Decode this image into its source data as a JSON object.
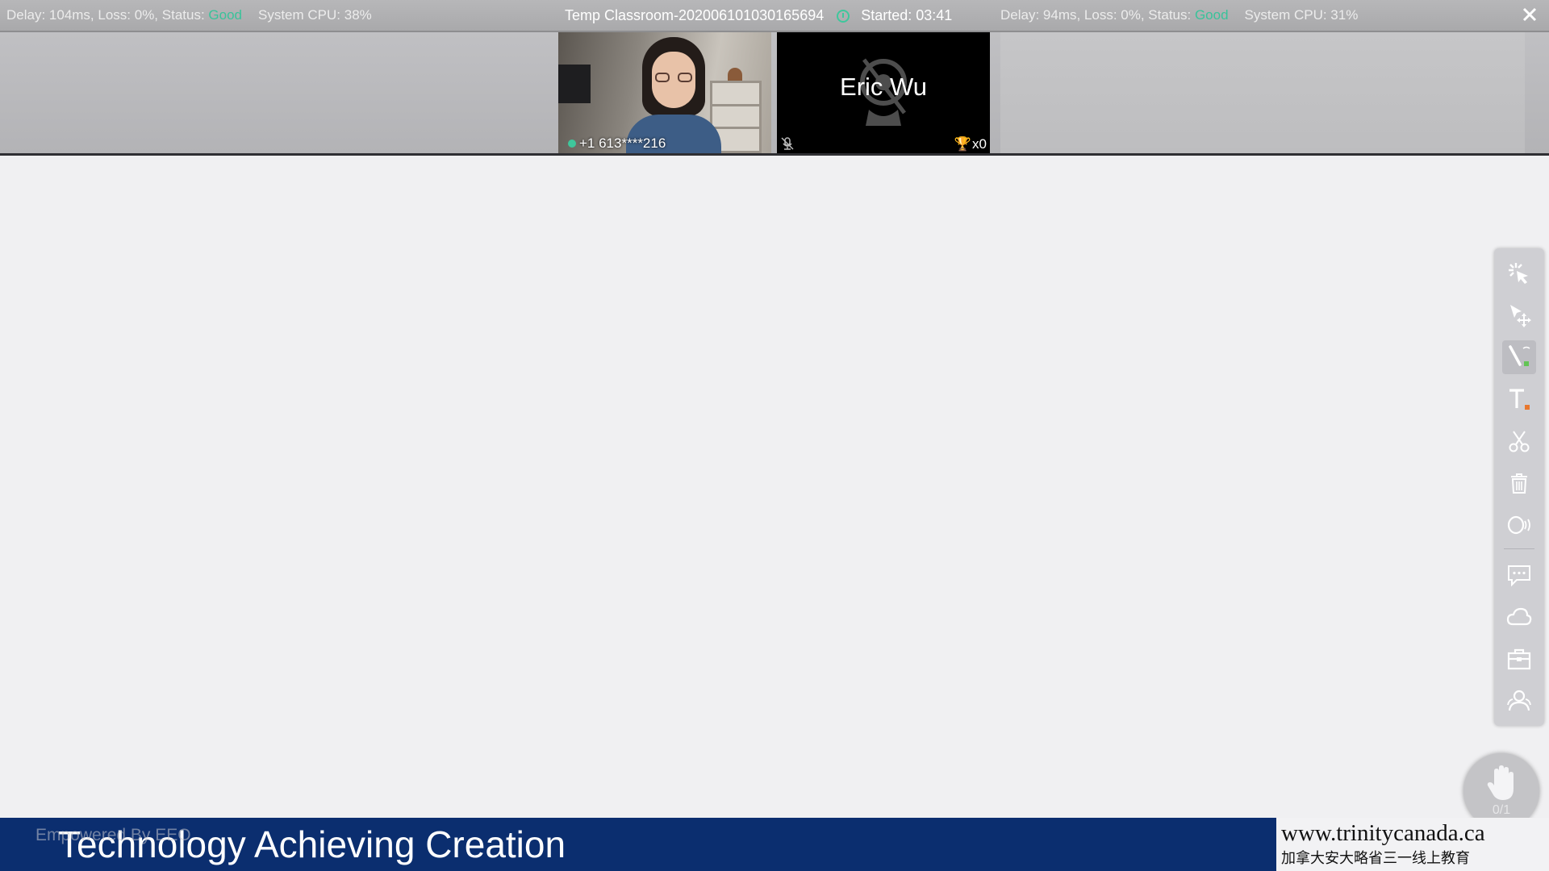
{
  "status_left": {
    "stats": "Delay: 104ms, Loss: 0%, Status: ",
    "status": "Good",
    "cpu": "System CPU: 38%"
  },
  "title": {
    "classroom": "Temp Classroom-202006101030165694",
    "started": "Started: 03:41"
  },
  "status_right": {
    "stats": "Delay: 94ms, Loss: 0%, Status: ",
    "status": "Good",
    "cpu": "System CPU: 31%"
  },
  "window": {
    "close_icon": "close-icon"
  },
  "videos": {
    "teacher": {
      "caption": "+1 613****216"
    },
    "student": {
      "name": "Eric Wu",
      "trophy_count": "x0"
    }
  },
  "toolbar": {
    "tools": [
      "laser-pointer-icon",
      "select-move-icon",
      "pen-icon",
      "text-icon",
      "scissors-icon",
      "trash-icon",
      "eraser-icon",
      "chat-icon",
      "cloud-icon",
      "toolbox-icon",
      "users-icon"
    ],
    "active_tool": "pen-icon"
  },
  "hand_raise": {
    "count": "0/1"
  },
  "banner": {
    "slogan": "Technology Achieving Creation",
    "powered": "Empowered By EEO"
  },
  "site": {
    "url": "www.trinitycanada.ca",
    "subtitle": "加拿大安大略省三一线上教育"
  },
  "colors": {
    "good": "#39c39a",
    "banner": "#0b2e6f",
    "accent_green": "#3ec79c"
  }
}
